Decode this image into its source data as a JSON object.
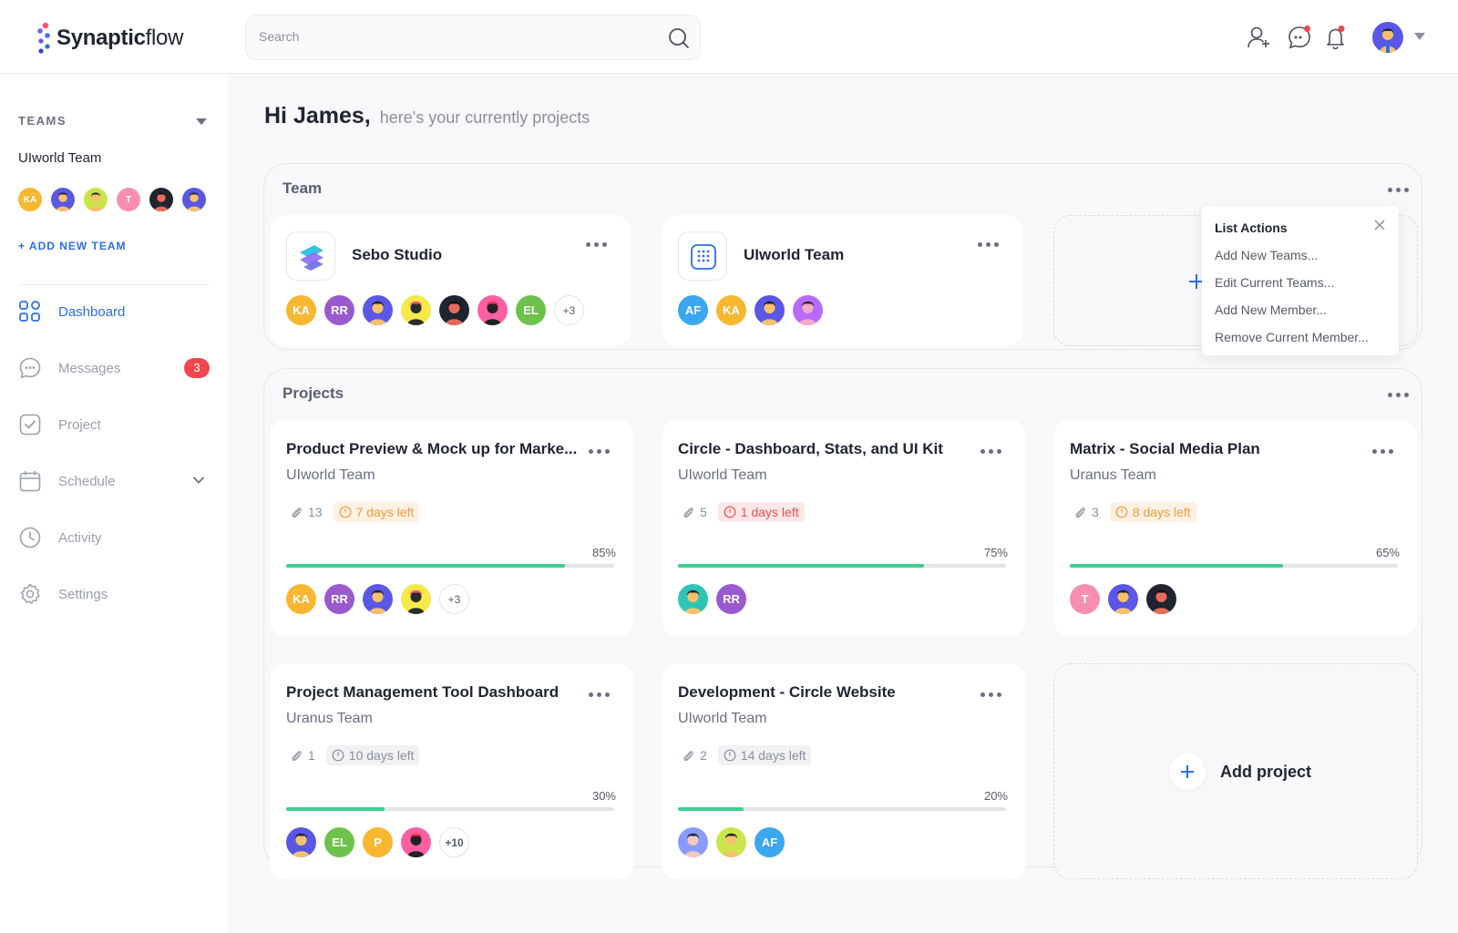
{
  "app": {
    "logo_bold": "Synaptic",
    "logo_light": "flow"
  },
  "search": {
    "placeholder": "Search"
  },
  "sidebar": {
    "teams_heading": "TEAMS",
    "team_name": "UIworld Team",
    "avatars": [
      {
        "initials": "KA",
        "color": "#f7b731"
      },
      {
        "initials": "",
        "color": "#5b57e6"
      },
      {
        "initials": "",
        "color": "#c8e64b"
      },
      {
        "initials": "T",
        "color": "#f78fb3"
      },
      {
        "initials": "",
        "color": "#1f2430"
      },
      {
        "initials": "",
        "color": "#5b57e6"
      }
    ],
    "add_team": "+ ADD NEW TEAM",
    "nav": [
      {
        "label": "Dashboard",
        "icon": "dashboard-icon",
        "active": true
      },
      {
        "label": "Messages",
        "icon": "messages-icon",
        "badge": "3"
      },
      {
        "label": "Project",
        "icon": "project-icon"
      },
      {
        "label": "Schedule",
        "icon": "calendar-icon"
      },
      {
        "label": "Activity",
        "icon": "clock-icon"
      },
      {
        "label": "Settings",
        "icon": "gear-icon"
      }
    ]
  },
  "greeting": {
    "title": "Hi James,",
    "subtitle": "here's your currently projects"
  },
  "team_panel": {
    "title": "Team",
    "cards": [
      {
        "name": "Sebo Studio",
        "more": "+3"
      },
      {
        "name": "UIworld Team"
      }
    ]
  },
  "list_actions": {
    "title": "List Actions",
    "items": [
      "Add New Teams...",
      "Edit Current Teams...",
      "Add New Member...",
      "Remove Current Member..."
    ]
  },
  "projects_panel": {
    "title": "Projects",
    "projects": [
      {
        "title": "Product Preview & Mock up for Marke...",
        "team": "UIworld Team",
        "attachments": "13",
        "deadline": "7 days left",
        "deadline_tone": "orange",
        "progress_label": "85%",
        "progress": 0.85,
        "more": "+3"
      },
      {
        "title": "Circle - Dashboard, Stats, and UI Kit",
        "team": "UIworld Team",
        "attachments": "5",
        "deadline": "1 days left",
        "deadline_tone": "red",
        "progress_label": "75%",
        "progress": 0.75
      },
      {
        "title": "Matrix - Social Media Plan",
        "team": "Uranus Team",
        "attachments": "3",
        "deadline": "8 days left",
        "deadline_tone": "orange",
        "progress_label": "65%",
        "progress": 0.65
      },
      {
        "title": "Project Management Tool Dashboard",
        "team": "Uranus Team",
        "attachments": "1",
        "deadline": "10 days left",
        "deadline_tone": "gray",
        "progress_label": "30%",
        "progress": 0.3,
        "more": "+10"
      },
      {
        "title": "Development - Circle Website",
        "team": "UIworld Team",
        "attachments": "2",
        "deadline": "14 days left",
        "deadline_tone": "gray",
        "progress_label": "20%",
        "progress": 0.2
      }
    ],
    "add_project": "Add project"
  },
  "colors": {
    "accent": "#2b6fe6",
    "progress": "#3ecf8e",
    "badge": "#f0474f"
  }
}
